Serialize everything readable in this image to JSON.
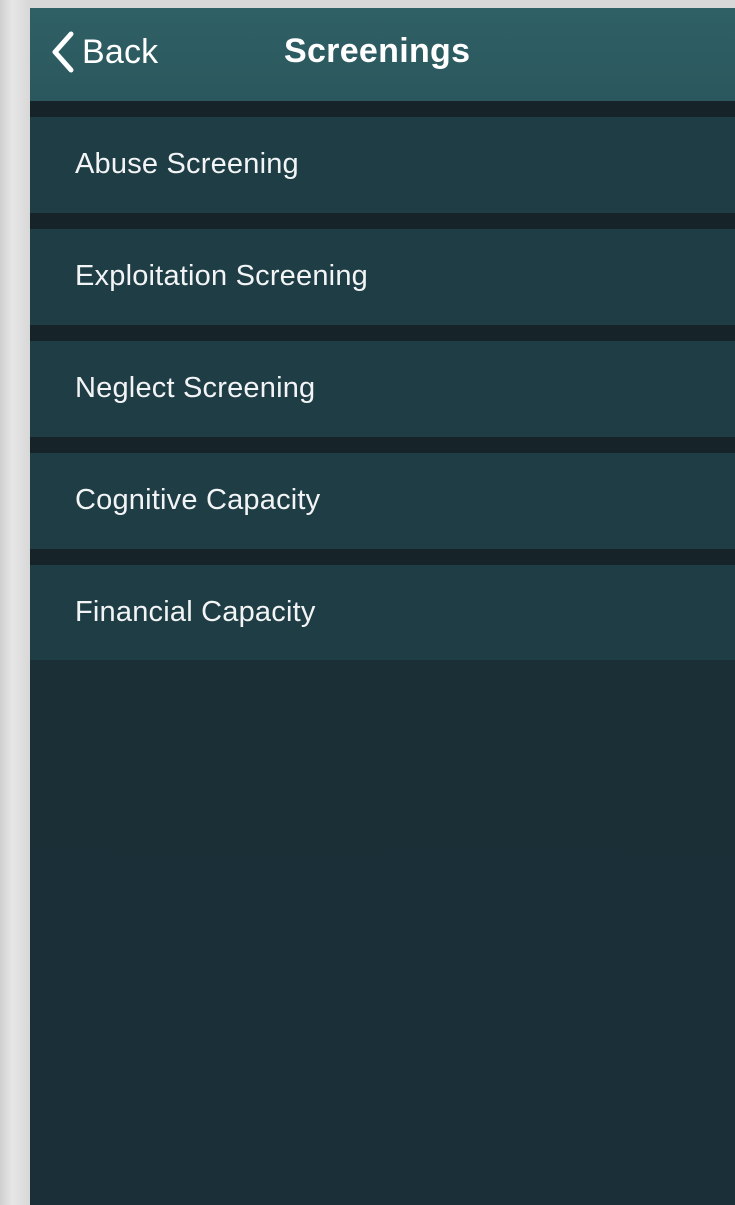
{
  "colors": {
    "navbar": "#2c5a60",
    "list_item": "#1f3d45",
    "separator": "#162328",
    "background": "#1a2e35",
    "text": "#ffffff"
  },
  "navbar": {
    "back_label": "Back",
    "back_icon": "chevron-left-icon",
    "title": "Screenings"
  },
  "screenings": {
    "items": [
      {
        "label": "Abuse Screening"
      },
      {
        "label": "Exploitation Screening"
      },
      {
        "label": "Neglect Screening"
      },
      {
        "label": "Cognitive Capacity"
      },
      {
        "label": "Financial Capacity"
      }
    ]
  }
}
